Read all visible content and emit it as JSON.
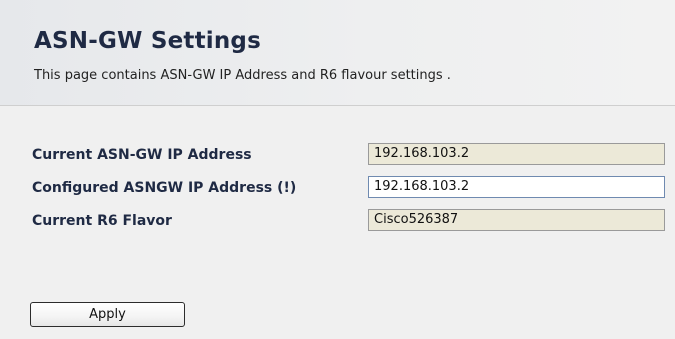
{
  "header": {
    "title": "ASN-GW Settings",
    "description": "This page contains ASN-GW IP Address and R6 flavour settings ."
  },
  "form": {
    "current_ip": {
      "label": "Current ASN-GW IP Address",
      "value": "192.168.103.2"
    },
    "configured_ip": {
      "label": "Configured ASNGW IP Address (!)",
      "value": "192.168.103.2"
    },
    "r6_flavor": {
      "label": "Current R6 Flavor",
      "value": "Cisco526387"
    },
    "apply_label": "Apply"
  },
  "colors": {
    "title": "#1f2a44",
    "readonly_field_bg": "#ece9d8",
    "page_bg": "#eeeeee"
  }
}
